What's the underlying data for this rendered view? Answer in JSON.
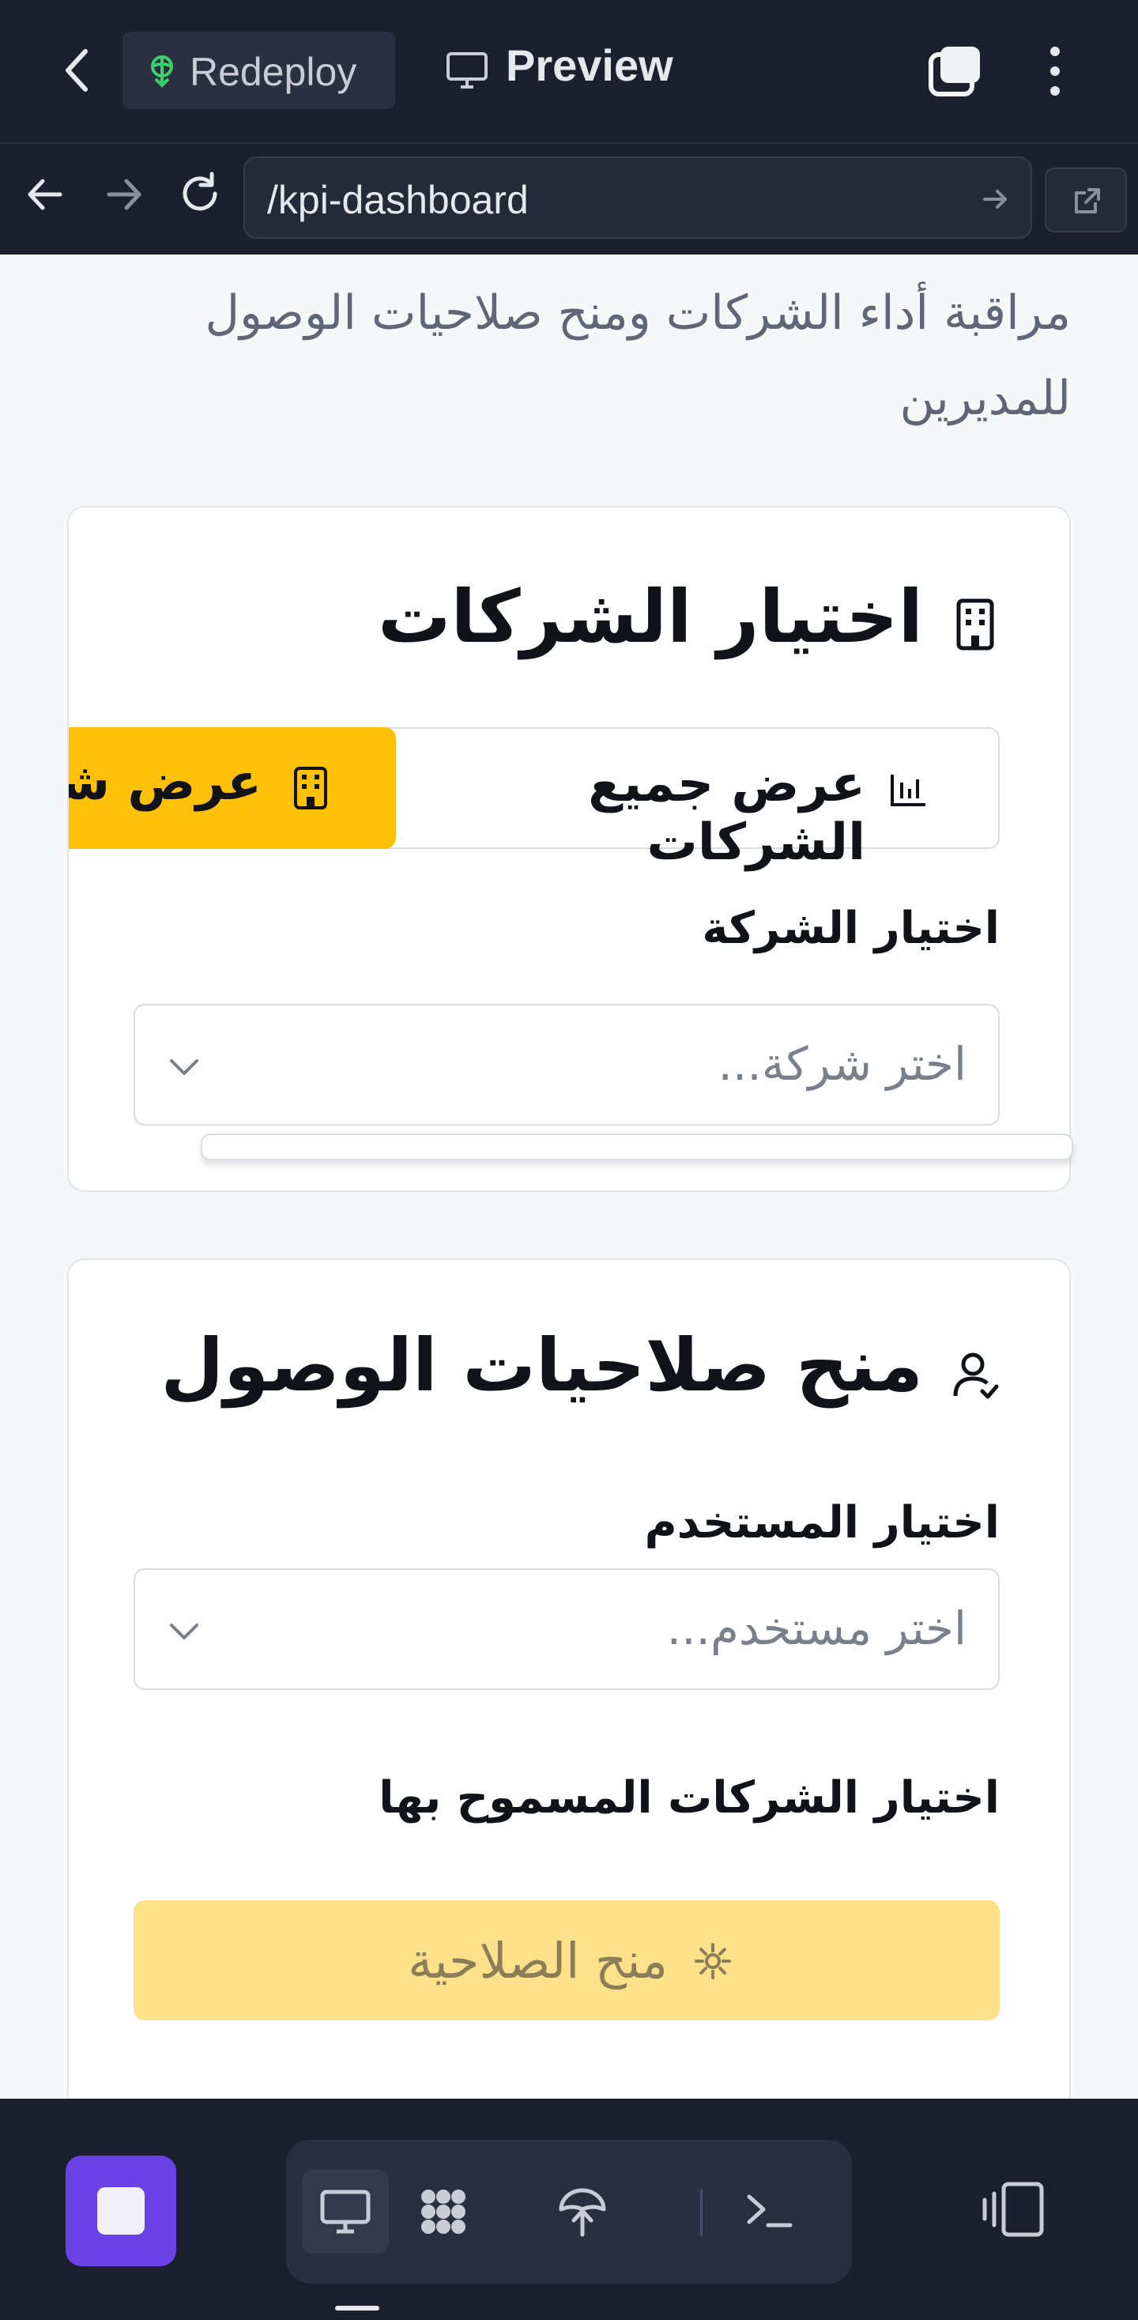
{
  "topbar": {
    "redeploy_label": "Redeploy",
    "preview_label": "Preview",
    "icons": [
      "back-chevron-icon",
      "redeploy-icon",
      "monitor-icon",
      "tabs-icon",
      "more-vertical-icon"
    ]
  },
  "navbar": {
    "url": "/kpi-dashboard",
    "icons": [
      "arrow-left-icon",
      "arrow-right-icon",
      "reload-icon",
      "go-arrow-icon",
      "external-link-icon"
    ]
  },
  "page": {
    "subtitle": "مراقبة أداء الشركات ومنح صلاحيات الوصول للمديرين"
  },
  "companies_card": {
    "title": "اختيار الشركات",
    "show_all_label": "عرض جميع الشركات",
    "show_one_label": "عرض شركة",
    "select_label": "اختيار الشركة",
    "select_placeholder": "اختر شركة..."
  },
  "access_card": {
    "title": "منح صلاحيات الوصول",
    "user_label": "اختيار المستخدم",
    "user_placeholder": "اختر مستخدم...",
    "companies_label": "اختيار الشركات المسموح بها",
    "grant_label": "منح الصلاحية"
  },
  "bottombar": {
    "icons": [
      "stop-icon",
      "desktop-icon",
      "apps-icon",
      "deploy-icon",
      "terminal-icon",
      "panel-toggle-icon"
    ]
  },
  "colors": {
    "topbar_bg": "#1b1f2e",
    "accent_yellow": "#ffc107",
    "disabled_yellow": "#fde18a",
    "stop_purple": "#6a42e5"
  }
}
